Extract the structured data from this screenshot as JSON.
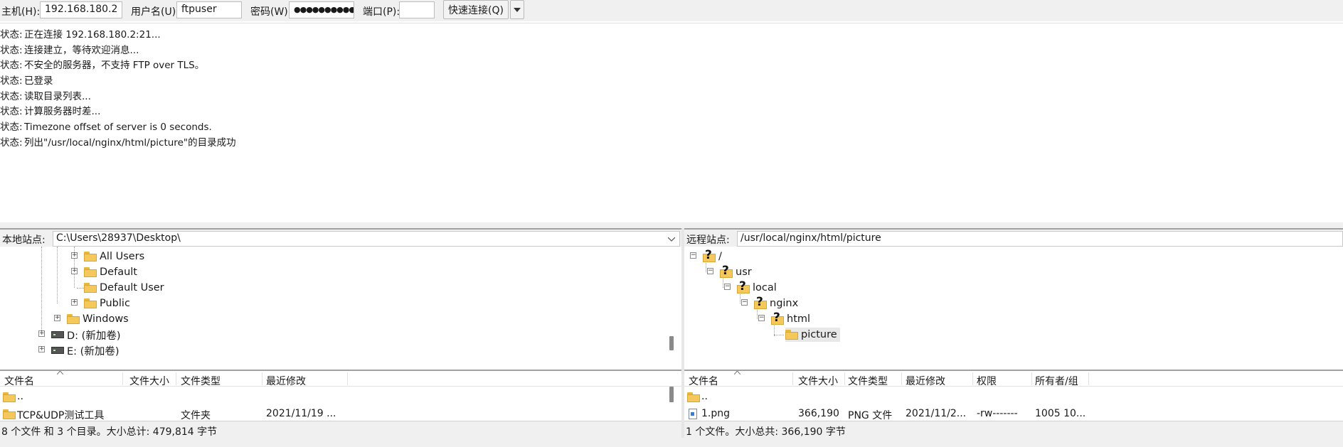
{
  "quickconnect": {
    "host_label": "主机(H):",
    "host_value": "192.168.180.2",
    "user_label": "用户名(U):",
    "user_value": "ftpuser",
    "pass_label": "密码(W):",
    "pass_value": "●●●●●●●●●●",
    "port_label": "端口(P):",
    "port_value": "",
    "connect_label": "快速连接(Q)",
    "dropdown_icon": "chevron-down-icon"
  },
  "log": [
    {
      "label": "状态:",
      "text": "正在连接 192.168.180.2:21..."
    },
    {
      "label": "状态:",
      "text": "连接建立，等待欢迎消息..."
    },
    {
      "label": "状态:",
      "text": "不安全的服务器，不支持 FTP over TLS。"
    },
    {
      "label": "状态:",
      "text": "已登录"
    },
    {
      "label": "状态:",
      "text": "读取目录列表..."
    },
    {
      "label": "状态:",
      "text": "计算服务器时差..."
    },
    {
      "label": "状态:",
      "text": "Timezone offset of server is 0 seconds."
    },
    {
      "label": "状态:",
      "text": "列出\"/usr/local/nginx/html/picture\"的目录成功"
    }
  ],
  "local": {
    "site_label": "本地站点:",
    "site_path": "C:\\Users\\28937\\Desktop\\",
    "tree": [
      {
        "label": "All Users",
        "expander": "+"
      },
      {
        "label": "Default",
        "expander": "+"
      },
      {
        "label": "Default User",
        "expander": ""
      },
      {
        "label": "Public",
        "expander": "+"
      },
      {
        "label": "Windows",
        "expander": "+"
      },
      {
        "label": "D: (新加卷)",
        "expander": "+"
      },
      {
        "label": "E: (新加卷)",
        "expander": "+"
      }
    ],
    "columns": [
      "文件名",
      "文件大小",
      "文件类型",
      "最近修改"
    ],
    "rows": [
      {
        "name": "..",
        "size": "",
        "type": "",
        "modified": ""
      },
      {
        "name": "TCP&UDP测试工具",
        "size": "",
        "type": "文件夹",
        "modified": "2021/11/19 ..."
      }
    ],
    "status": "8 个文件 和 3 个目录。大小总计: 479,814 字节"
  },
  "remote": {
    "site_label": "远程站点:",
    "site_path": "/usr/local/nginx/html/picture",
    "tree": [
      {
        "label": "/",
        "expander": "−"
      },
      {
        "label": "usr",
        "expander": "−"
      },
      {
        "label": "local",
        "expander": "−"
      },
      {
        "label": "nginx",
        "expander": "−"
      },
      {
        "label": "html",
        "expander": "−"
      },
      {
        "label": "picture",
        "expander": ""
      }
    ],
    "columns": [
      "文件名",
      "文件大小",
      "文件类型",
      "最近修改",
      "权限",
      "所有者/组"
    ],
    "rows": [
      {
        "name": "..",
        "size": "",
        "type": "",
        "modified": "",
        "perm": "",
        "owner": ""
      },
      {
        "name": "1.png",
        "size": "366,190",
        "type": "PNG 文件",
        "modified": "2021/11/2...",
        "perm": "-rw-------",
        "owner": "1005 10..."
      }
    ],
    "status": "1 个文件。大小总共: 366,190 字节"
  }
}
